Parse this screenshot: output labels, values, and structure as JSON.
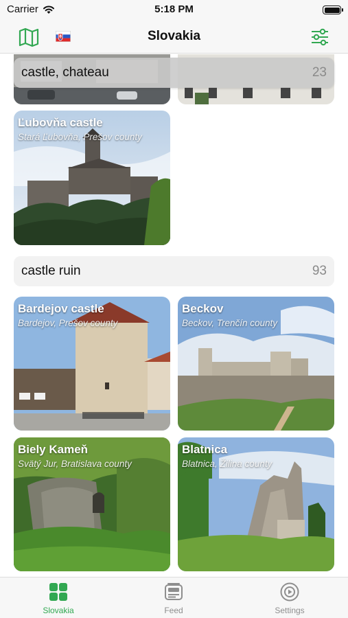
{
  "status_bar": {
    "carrier": "Carrier",
    "time": "5:18 PM"
  },
  "nav": {
    "title": "Slovakia"
  },
  "sections": [
    {
      "label": "castle, chateau",
      "count": "23"
    },
    {
      "label": "castle ruin",
      "count": "93"
    }
  ],
  "cards": [
    {
      "title": "Ľubovňa castle",
      "subtitle": "Stará Ľubovňa, Prešov county"
    },
    {
      "title": "Bardejov castle",
      "subtitle": "Bardejov, Prešov county"
    },
    {
      "title": "Beckov",
      "subtitle": "Beckov, Trenčín county"
    },
    {
      "title": "Biely Kameň",
      "subtitle": "Svätý Jur, Bratislava county"
    },
    {
      "title": "Blatnica",
      "subtitle": "Blatnica, Žilina county"
    }
  ],
  "tabs": [
    {
      "label": "Slovakia",
      "icon": "grid-icon",
      "active": true
    },
    {
      "label": "Feed",
      "icon": "feed-icon",
      "active": false
    },
    {
      "label": "Settings",
      "icon": "settings-icon",
      "active": false
    }
  ],
  "colors": {
    "accent": "#32a852",
    "tab_inactive": "#8e8e8e",
    "header_bg": "#f2f2f2"
  }
}
